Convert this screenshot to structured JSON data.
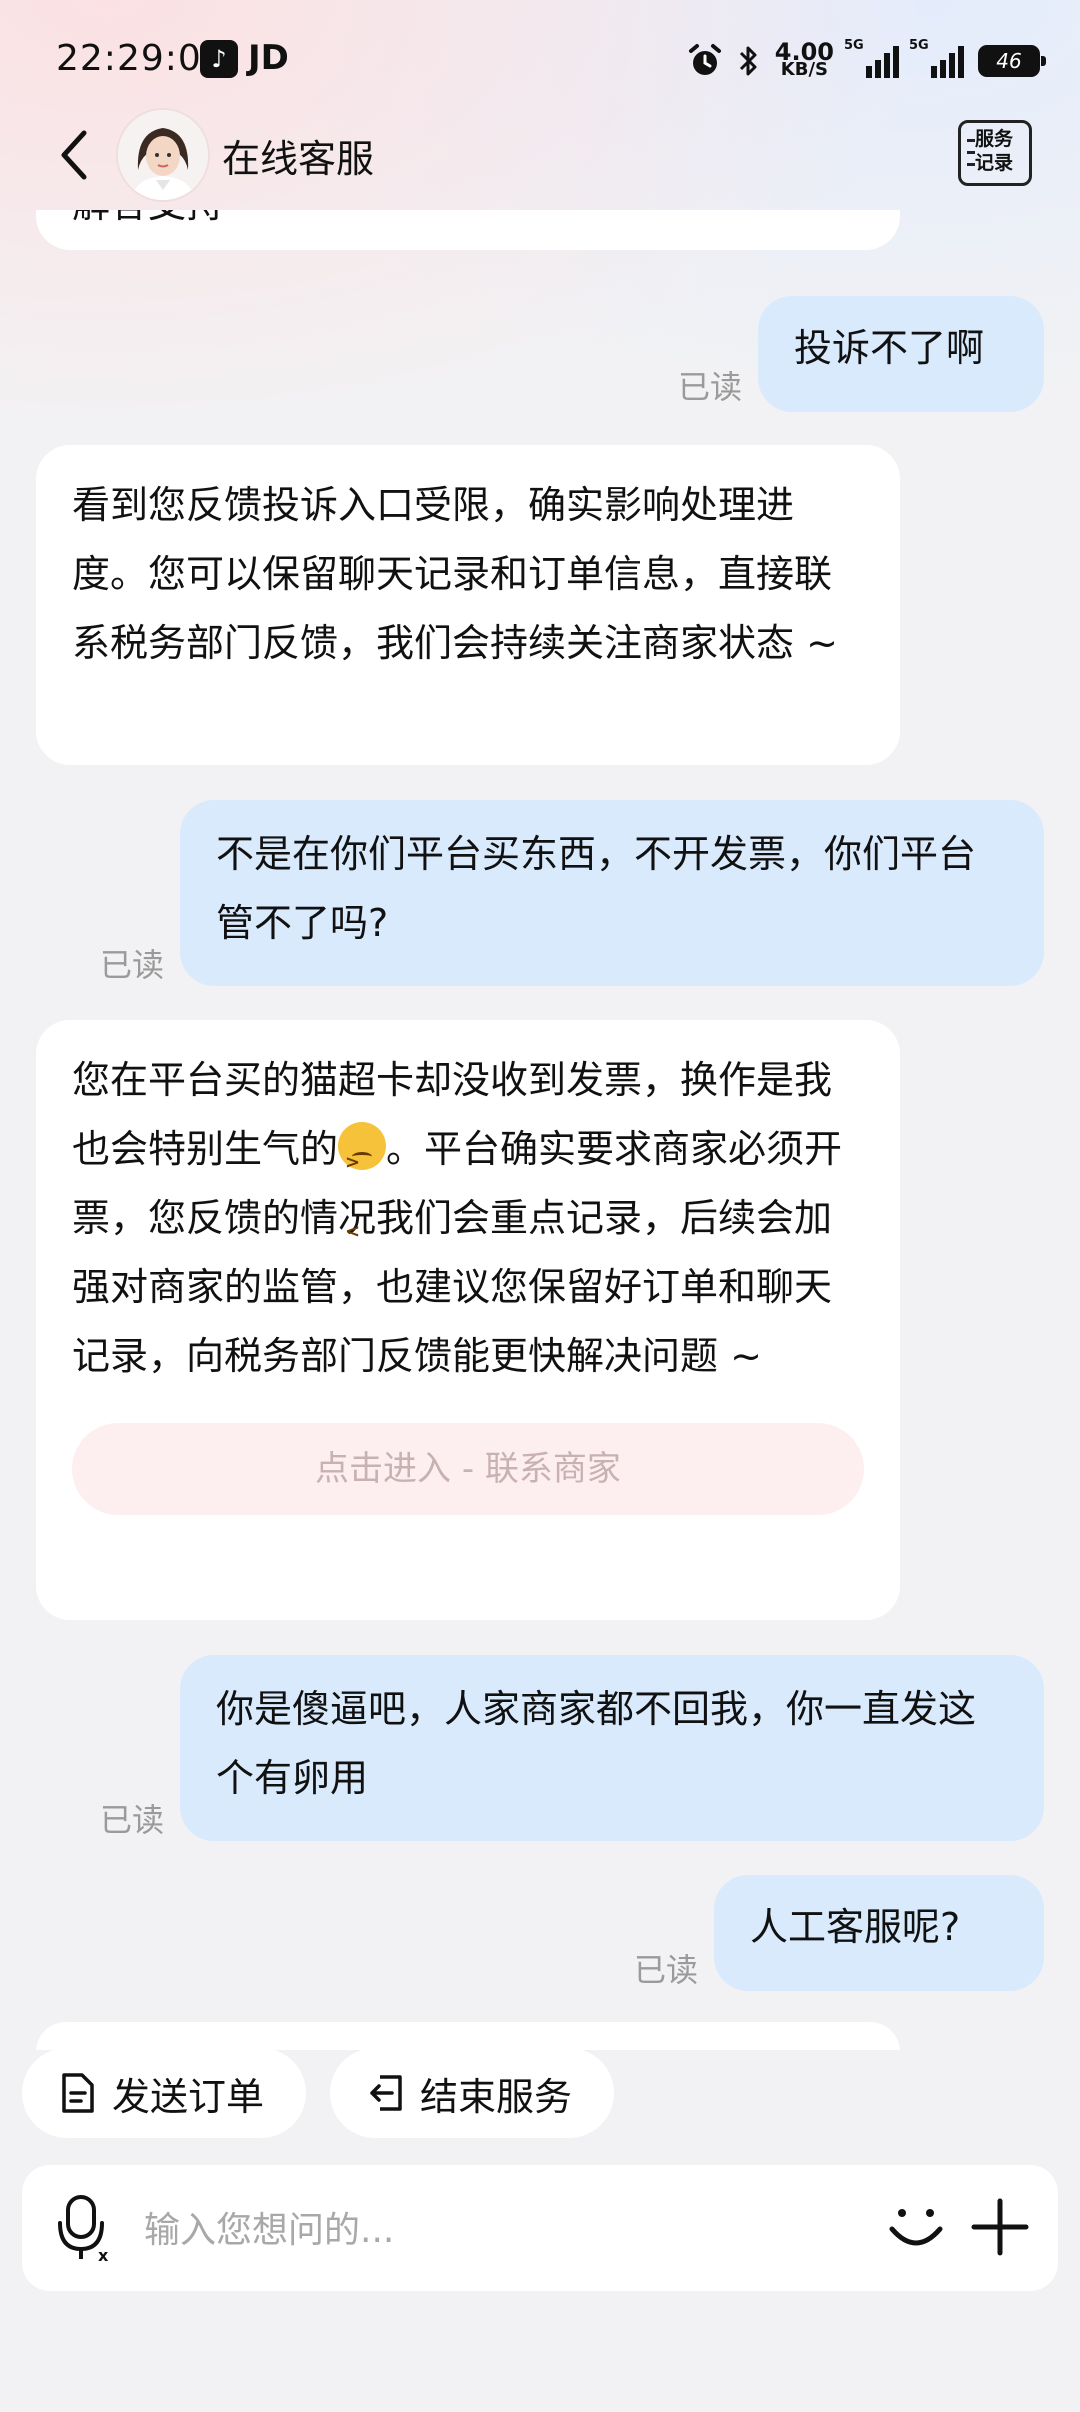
{
  "status_bar": {
    "time": "22:29:05",
    "app_label": "JD",
    "speed_value": "4.00",
    "speed_unit": "KB/S",
    "signal1_label": "5G",
    "signal2_label": "5G",
    "battery": "46"
  },
  "header": {
    "title": "在线客服",
    "service_record_label": "服务\n记录"
  },
  "messages": {
    "m1": "解答支持~",
    "m2": "投诉不了啊",
    "m2_status": "已读",
    "m3": "看到您反馈投诉入口受限，确实影响处理进度。您可以保留聊天记录和订单信息，直接联系税务部门反馈，我们会持续关注商家状态 ~",
    "m4": "不是在你们平台买东西，不开发票，你们平台管不了吗?",
    "m4_status": "已读",
    "m5_part1": "您在平台买的猫超卡却没收到发票，换作是我也会特别生气的",
    "m5_part2": "。平台确实要求商家必须开票，您反馈的情况我们会重点记录，后续会加强对商家的监管，也建议您保留好订单和聊天记录，向税务部门反馈能更快解决问题 ~",
    "m5_button": "点击进入 - 联系商家",
    "m6": "你是傻逼吧，人家商家都不回我，你一直发这个有卵用",
    "m6_status": "已读",
    "m7": "人工客服呢?",
    "m7_status": "已读"
  },
  "quick_actions": {
    "send_order": "发送订单",
    "end_service": "结束服务"
  },
  "input": {
    "placeholder": "输入您想问的..."
  },
  "colors": {
    "user_bubble": "#d9eafd",
    "agent_bubble": "#ffffff",
    "background": "#f2f2f4",
    "link_button_bg": "#fdeef0"
  }
}
